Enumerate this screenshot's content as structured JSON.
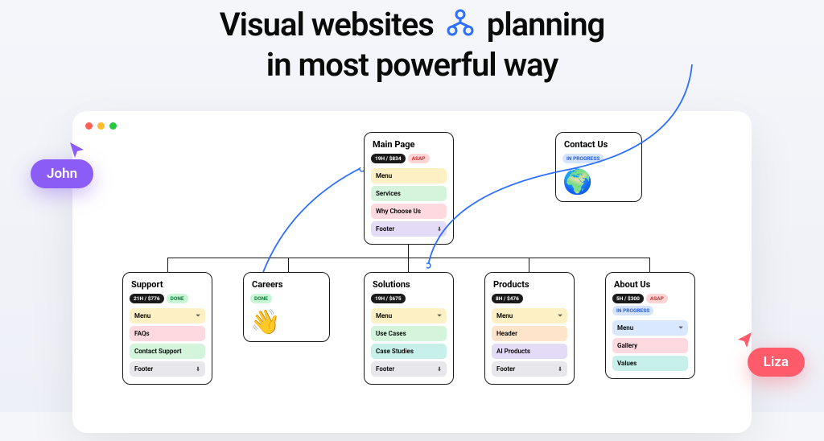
{
  "heading": {
    "line1_a": "Visual websites",
    "line1_b": "planning",
    "line2": "in most powerful way"
  },
  "cursors": {
    "john": "John",
    "liza": "Liza"
  },
  "cards": {
    "main": {
      "title": "Main Page",
      "budget": "19H / $834",
      "status": "ASAP",
      "sections": [
        "Menu",
        "Services",
        "Why Choose Us",
        "Footer"
      ]
    },
    "contact": {
      "title": "Contact Us",
      "status": "IN PROGRESS",
      "emoji": "🌍"
    },
    "support": {
      "title": "Support",
      "budget": "21H / $776",
      "status": "DONE",
      "sections": [
        "Menu",
        "FAQs",
        "Contact Support",
        "Footer"
      ]
    },
    "careers": {
      "title": "Careers",
      "status": "DONE",
      "emoji": "👋"
    },
    "solutions": {
      "title": "Solutions",
      "budget": "19H / $675",
      "sections": [
        "Menu",
        "Use Cases",
        "Case Studies",
        "Footer"
      ]
    },
    "products": {
      "title": "Products",
      "budget": "8H / $476",
      "sections": [
        "Menu",
        "Header",
        "AI Products",
        "Footer"
      ]
    },
    "about": {
      "title": "About Us",
      "budget": "5H / $300",
      "status1": "ASAP",
      "status2": "IN PROGRESS",
      "sections": [
        "Menu",
        "Gallery",
        "Values"
      ]
    }
  }
}
